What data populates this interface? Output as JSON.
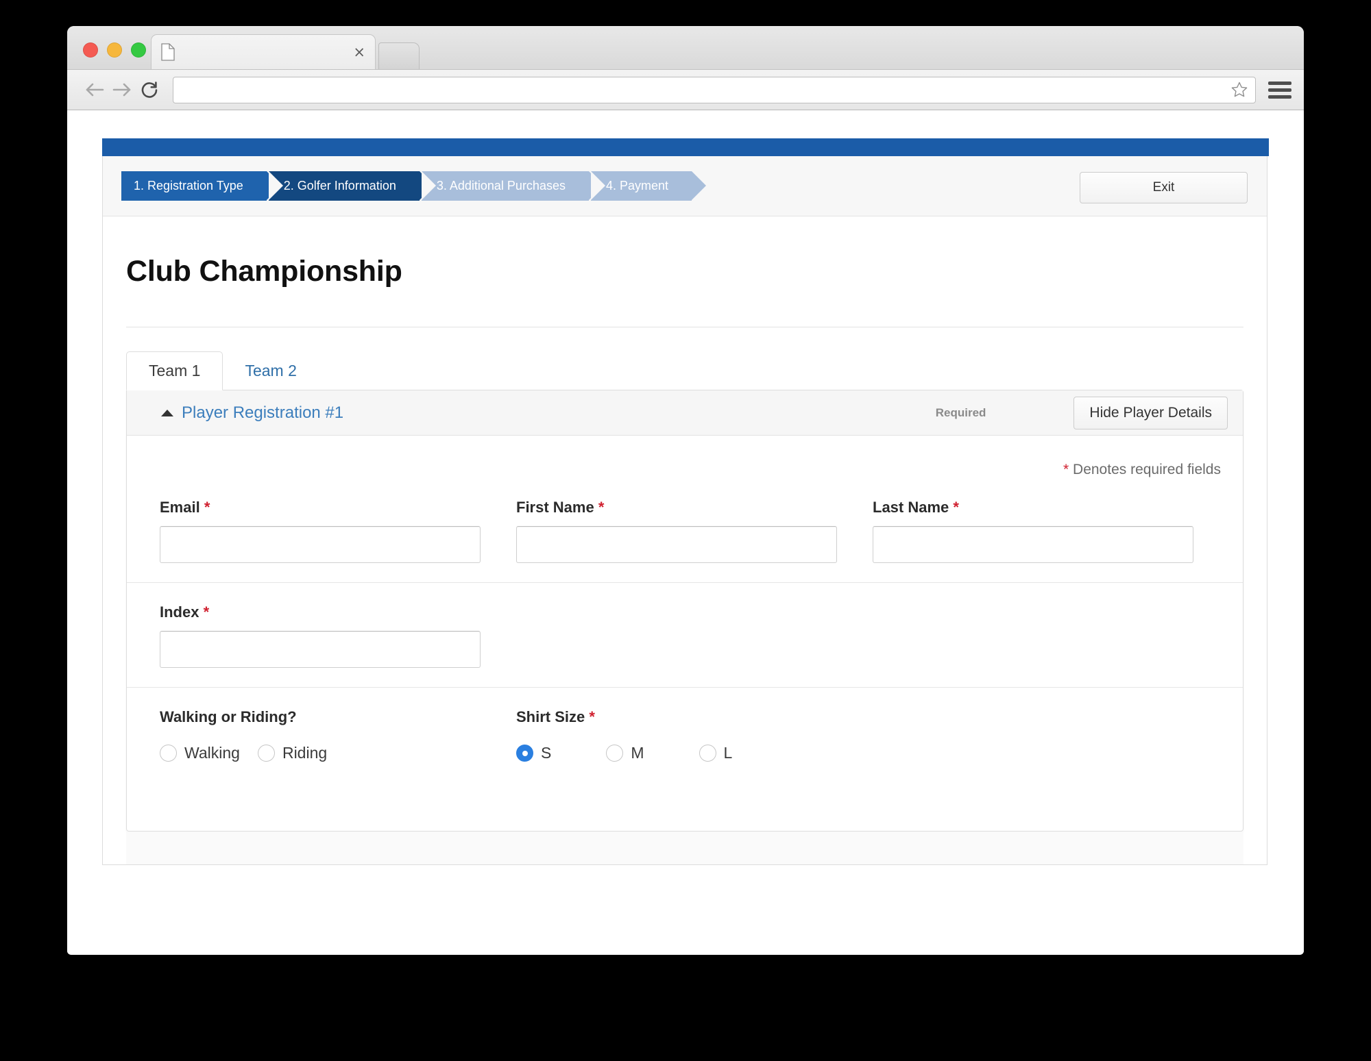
{
  "browser": {
    "tab_title": "",
    "tab_icon": "page-icon",
    "close_icon": "×",
    "url_value": "",
    "url_placeholder": "",
    "back_icon": "back-arrow-icon",
    "forward_icon": "forward-arrow-icon",
    "reload_icon": "reload-icon",
    "bookmark_icon": "star-icon",
    "menu_icon": "hamburger-menu-icon"
  },
  "wizard": {
    "steps": [
      {
        "label": "1. Registration Type",
        "state": "done"
      },
      {
        "label": "2. Golfer Information",
        "state": "active"
      },
      {
        "label": "3. Additional Purchases",
        "state": "todo"
      },
      {
        "label": "4. Payment",
        "state": "todo"
      }
    ],
    "exit_label": "Exit",
    "accent_done": "#1f63ad",
    "accent_active": "#134880",
    "accent_todo": "#a8bedb",
    "topbar_color": "#1b5ca8"
  },
  "page": {
    "title": "Club Championship"
  },
  "team_tabs": [
    {
      "label": "Team 1",
      "active": true
    },
    {
      "label": "Team 2",
      "active": false
    }
  ],
  "player_card": {
    "heading": "Player Registration #1",
    "caret_icon": "caret-up-icon",
    "required_tag": "Required",
    "hide_button": "Hide Player Details",
    "denotes_asterisk": "*",
    "denotes_text": "Denotes required fields",
    "required_color": "#d0202f",
    "fields": [
      {
        "label": "Email",
        "required": true,
        "value": "",
        "placeholder": ""
      },
      {
        "label": "First Name",
        "required": true,
        "value": "",
        "placeholder": ""
      },
      {
        "label": "Last Name",
        "required": true,
        "value": "",
        "placeholder": ""
      },
      {
        "label": "Index",
        "required": true,
        "value": "",
        "placeholder": ""
      }
    ],
    "radio_groups": [
      {
        "label": "Walking or Riding?",
        "required": false,
        "options": [
          {
            "label": "Walking",
            "checked": false
          },
          {
            "label": "Riding",
            "checked": false
          }
        ]
      },
      {
        "label": "Shirt Size",
        "required": true,
        "options": [
          {
            "label": "S",
            "checked": true
          },
          {
            "label": "M",
            "checked": false
          },
          {
            "label": "L",
            "checked": false
          }
        ]
      }
    ]
  }
}
